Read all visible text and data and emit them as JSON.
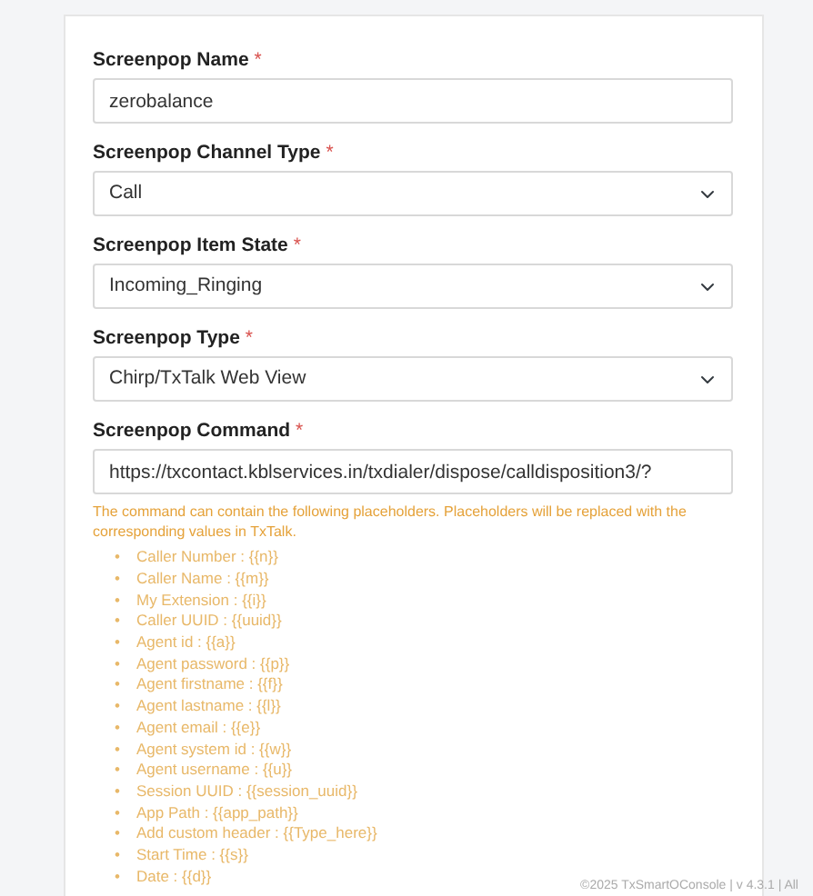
{
  "fields": [
    {
      "label": "Screenpop Name",
      "required_mark": "*",
      "kind": "input",
      "value": "zerobalance"
    },
    {
      "label": "Screenpop Channel Type",
      "required_mark": "*",
      "kind": "select",
      "value": "Call"
    },
    {
      "label": "Screenpop Item State",
      "required_mark": "*",
      "kind": "select",
      "value": "Incoming_Ringing"
    },
    {
      "label": "Screenpop Type",
      "required_mark": "*",
      "kind": "select",
      "value": "Chirp/TxTalk Web View"
    },
    {
      "label": "Screenpop Command",
      "required_mark": "*",
      "kind": "input",
      "value": "https://txcontact.kblservices.in/txdialer/dispose/calldisposition3/?"
    }
  ],
  "help_text": "The command can contain the following placeholders. Placeholders will be replaced with the corresponding values in TxTalk.",
  "bullet": "•",
  "placeholders": [
    "Caller Number : {{n}}",
    "Caller Name : {{m}}",
    "My Extension : {{i}}",
    "Caller UUID : {{uuid}}",
    "Agent id : {{a}}",
    "Agent password : {{p}}",
    "Agent firstname : {{f}}",
    "Agent lastname : {{l}}",
    "Agent email : {{e}}",
    "Agent system id : {{w}}",
    "Agent username : {{u}}",
    "Session UUID : {{session_uuid}}",
    "App Path : {{app_path}}",
    "Add custom header : {{Type_here}}",
    "Start Time : {{s}}",
    "Date : {{d}}"
  ],
  "footer": "©2025 TxSmartOConsole | v 4.3.1 | All"
}
